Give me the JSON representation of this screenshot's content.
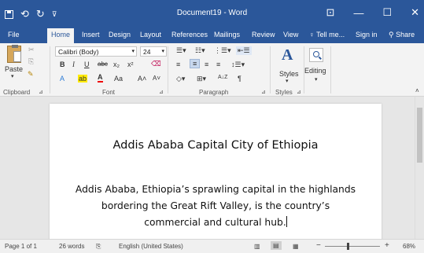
{
  "titlebar": {
    "title": "Document19 - Word",
    "save_icon": "save-icon",
    "undo_glyph": "⟲",
    "redo_glyph": "↻",
    "customize_glyph": "⊽",
    "ribbon_display_glyph": "⊡",
    "minimize_glyph": "—",
    "restore_glyph": "☐",
    "close_glyph": "✕"
  },
  "tabs": {
    "file": "File",
    "home": "Home",
    "insert": "Insert",
    "design": "Design",
    "layout": "Layout",
    "references": "References",
    "mailings": "Mailings",
    "review": "Review",
    "view": "View",
    "tell_me": "Tell me...",
    "sign_in": "Sign in",
    "share": "Share"
  },
  "ribbon": {
    "clipboard": {
      "label": "Clipboard",
      "paste": "Paste"
    },
    "font": {
      "label": "Font",
      "font_name": "Calibri (Body)",
      "font_size": "24",
      "bold": "B",
      "italic": "I",
      "underline": "U",
      "strike": "abc",
      "subscript": "x₂",
      "superscript": "x²",
      "text_effects": "A",
      "highlight": "ab",
      "font_color": "A",
      "change_case": "Aa",
      "grow": "A˄",
      "shrink": "A˅"
    },
    "paragraph": {
      "label": "Paragraph",
      "sort": "A↓Z",
      "pilcrow": "¶"
    },
    "styles": {
      "label": "Styles",
      "button": "Styles"
    },
    "editing": {
      "button": "Editing"
    }
  },
  "document": {
    "title": "Addis Ababa Capital City of Ethiopia",
    "body": "Addis Ababa, Ethiopia’s sprawling capital in the highlands bordering the Great Rift Valley, is the country’s commercial and cultural hub."
  },
  "status": {
    "page": "Page 1 of 1",
    "words": "26 words",
    "language": "English (United States)",
    "zoom": "68%",
    "zoom_minus": "−",
    "zoom_plus": "+"
  },
  "colors": {
    "titlebar": "#2b579a",
    "ribbon": "#f3f3f3",
    "canvas": "#e6e6e6"
  }
}
